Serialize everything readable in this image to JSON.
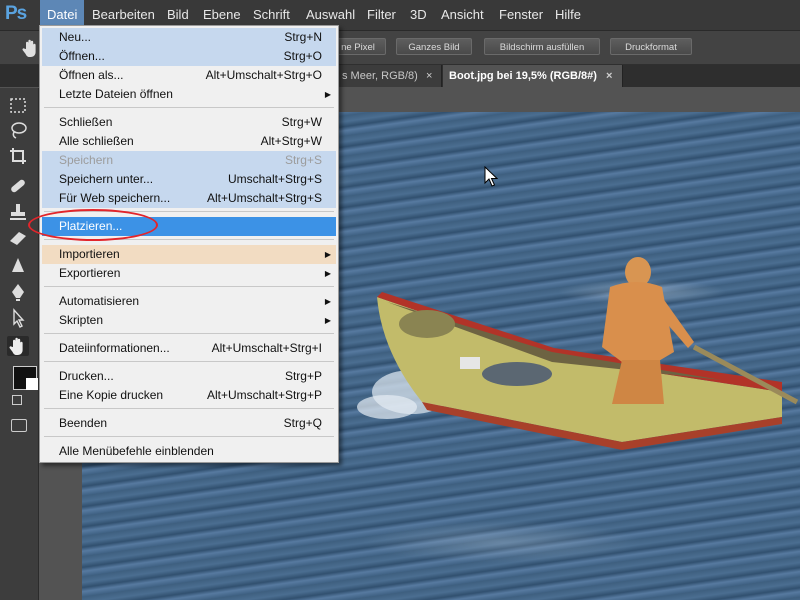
{
  "app": {
    "logo": "Ps",
    "menu": [
      "Datei",
      "Bearbeiten",
      "Bild",
      "Ebene",
      "Schrift",
      "Auswahl",
      "Filter",
      "3D",
      "Ansicht",
      "Fenster",
      "Hilfe"
    ]
  },
  "options_bar": {
    "buttons": [
      "ne Pixel",
      "Ganzes Bild",
      "Bildschirm ausfüllen",
      "Druckformat"
    ]
  },
  "tabs": [
    {
      "label": "s Meer, RGB/8)",
      "active": false
    },
    {
      "label": "Boot.jpg bei 19,5% (RGB/8#)",
      "active": true
    }
  ],
  "tab_close_glyph": "×",
  "collapse_glyph": "◂◂",
  "file_menu": {
    "items": [
      {
        "label": "Neu...",
        "shortcut": "Strg+N",
        "state": "hl-blue"
      },
      {
        "label": "Öffnen...",
        "shortcut": "Strg+O",
        "state": "hl-blue"
      },
      {
        "label": "Öffnen als...",
        "shortcut": "Alt+Umschalt+Strg+O",
        "state": ""
      },
      {
        "label": "Letzte Dateien öffnen",
        "shortcut": "",
        "submenu": true,
        "state": ""
      },
      {
        "label": "Schließen",
        "shortcut": "Strg+W",
        "state": ""
      },
      {
        "label": "Alle schließen",
        "shortcut": "Alt+Strg+W",
        "state": ""
      },
      {
        "label": "Speichern",
        "shortcut": "Strg+S",
        "state": "disabled"
      },
      {
        "label": "Speichern unter...",
        "shortcut": "Umschalt+Strg+S",
        "state": "hl-blue"
      },
      {
        "label": "Für Web speichern...",
        "shortcut": "Alt+Umschalt+Strg+S",
        "state": "hl-blue"
      },
      {
        "label": "Platzieren...",
        "shortcut": "",
        "state": "selected"
      },
      {
        "label": "Importieren",
        "shortcut": "",
        "submenu": true,
        "state": "hl-orange"
      },
      {
        "label": "Exportieren",
        "shortcut": "",
        "submenu": true,
        "state": ""
      },
      {
        "label": "Automatisieren",
        "shortcut": "",
        "submenu": true,
        "state": ""
      },
      {
        "label": "Skripten",
        "shortcut": "",
        "submenu": true,
        "state": ""
      },
      {
        "label": "Dateiinformationen...",
        "shortcut": "Alt+Umschalt+Strg+I",
        "state": ""
      },
      {
        "label": "Drucken...",
        "shortcut": "Strg+P",
        "state": ""
      },
      {
        "label": "Eine Kopie drucken",
        "shortcut": "Alt+Umschalt+Strg+P",
        "state": ""
      },
      {
        "label": "Beenden",
        "shortcut": "Strg+Q",
        "state": ""
      },
      {
        "label": "Alle Menübefehle einblenden",
        "shortcut": "",
        "state": ""
      }
    ],
    "submenu_glyph": "▶"
  },
  "colors": {
    "accent_selected": "#3c92e6",
    "highlight_blue": "#c6d8ee",
    "highlight_orange": "#f2dcc2",
    "annotation_red": "#e2252b"
  }
}
